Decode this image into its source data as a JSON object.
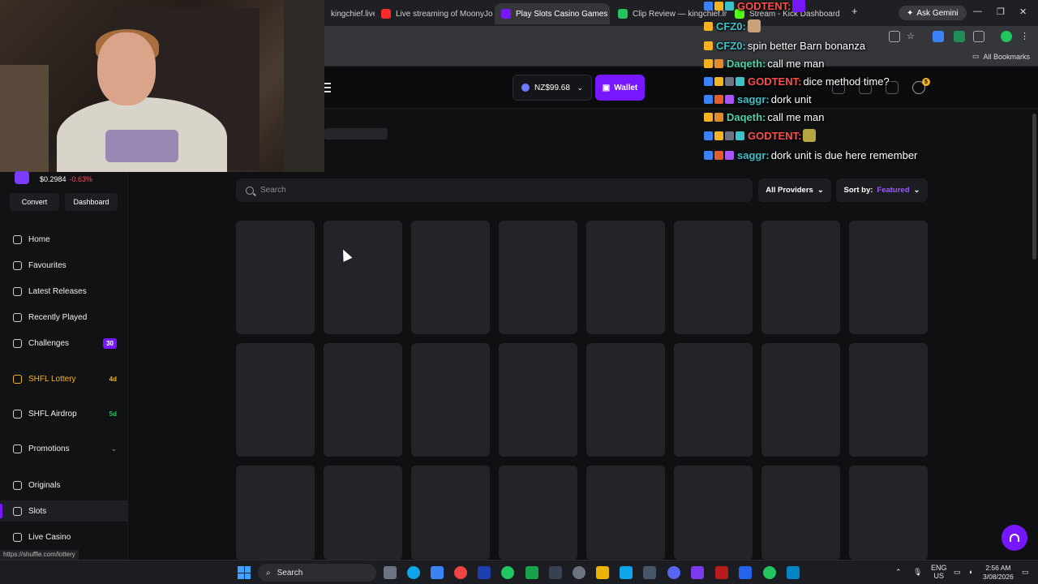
{
  "browser": {
    "tabs": [
      {
        "label": "kingchief.live",
        "active": false
      },
      {
        "label": "Live streaming of MoonyJol",
        "active": false
      },
      {
        "label": "Play Slots Casino Games | S",
        "active": true
      },
      {
        "label": "Clip Review — kingchief.live",
        "active": false
      },
      {
        "label": "Stream - Kick Dashboard",
        "active": false
      }
    ],
    "ask_gemini": "Ask Gemini",
    "all_bookmarks": "All Bookmarks",
    "status_url": "https://shuffle.com/lottery"
  },
  "header": {
    "balance": "NZ$99.68",
    "wallet_label": "Wallet",
    "notification_count": "5"
  },
  "sidebar": {
    "token_price": "$0.2984",
    "token_change": "-0.63%",
    "convert_label": "Convert",
    "dashboard_label": "Dashboard",
    "items": [
      {
        "label": "Home",
        "icon": "home-icon"
      },
      {
        "label": "Favourites",
        "icon": "star-icon"
      },
      {
        "label": "Latest Releases",
        "icon": "new-releases-icon"
      },
      {
        "label": "Recently Played",
        "icon": "history-icon"
      },
      {
        "label": "Challenges",
        "icon": "target-icon",
        "badge": "30"
      },
      {
        "label": "SHFL Lottery",
        "icon": "lottery-icon",
        "badge": "4d"
      },
      {
        "label": "SHFL Airdrop",
        "icon": "airdrop-icon",
        "badge": "5d"
      },
      {
        "label": "Promotions",
        "icon": "gift-icon"
      },
      {
        "label": "Originals",
        "icon": "originals-icon"
      },
      {
        "label": "Slots",
        "icon": "slots-icon"
      },
      {
        "label": "Live Casino",
        "icon": "live-casino-icon"
      }
    ]
  },
  "main": {
    "search_placeholder": "Search",
    "providers_label": "All Providers",
    "sort_prefix": "Sort by:",
    "sort_value": "Featured"
  },
  "chat": [
    {
      "user": "GODTENT:",
      "color": "#ff4d4d",
      "msg": ""
    },
    {
      "user": "CFZ0:",
      "color": "#3ec1c9",
      "msg": ""
    },
    {
      "user": "CFZ0:",
      "color": "#3ec1c9",
      "msg": "spin better Barn bonanza"
    },
    {
      "user": "Daqeth:",
      "color": "#4fd1a5",
      "msg": "call me man"
    },
    {
      "user": "GODTENT:",
      "color": "#ff4d4d",
      "msg": "dice method time?"
    },
    {
      "user": "saggr:",
      "color": "#3ec1c9",
      "msg": "dork unit"
    },
    {
      "user": "Daqeth:",
      "color": "#4fd1a5",
      "msg": "call me man"
    },
    {
      "user": "GODTENT:",
      "color": "#ff4d4d",
      "msg": ""
    },
    {
      "user": "saggr:",
      "color": "#3ec1c9",
      "msg": "dork unit is due here remember"
    }
  ],
  "taskbar": {
    "search_label": "Search",
    "lang_line1": "ENG",
    "lang_line2": "US",
    "time": "2:56 AM",
    "date": "3/08/2026"
  },
  "colors": {
    "accent": "#7717ff",
    "gold": "#f5b323",
    "negative": "#ff4d6a"
  }
}
